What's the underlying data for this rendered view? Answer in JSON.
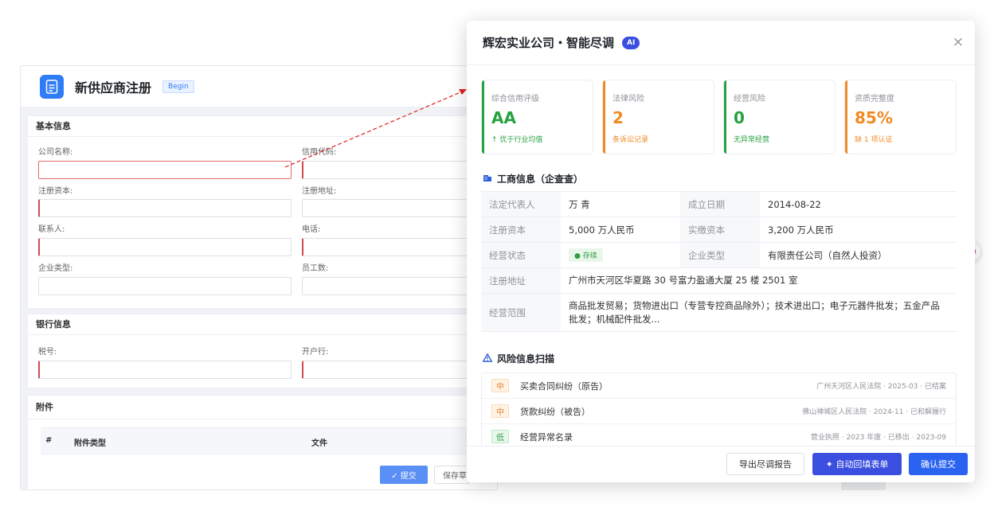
{
  "form": {
    "title": "新供应商注册",
    "tag": "Begin",
    "basic_section": "基本信息",
    "labels": {
      "company_name": "公司名称:",
      "credit_code": "信用代码:",
      "reg_capital": "注册资本:",
      "reg_address": "注册地址:",
      "contact": "联系人:",
      "phone": "电话:",
      "ent_type": "企业类型:",
      "employees": "员工数:",
      "tax_no": "税号:",
      "bank": "开户行:"
    },
    "bank_section": "银行信息",
    "attach_section": "附件",
    "attach_cols": [
      "#",
      "附件类型",
      "文件"
    ],
    "submit": "✓ 提交",
    "save_draft": "保存草"
  },
  "panel": {
    "title": "辉宏实业公司・智能尽调",
    "ai_badge": "AI",
    "close": "×",
    "cards": [
      {
        "label": "综合信用评级",
        "value": "AA",
        "sub": "↑ 优于行业均值",
        "color": "#27a243"
      },
      {
        "label": "法律风险",
        "value": "2",
        "sub": "条诉讼记录",
        "color": "#ef8a24"
      },
      {
        "label": "经营风险",
        "value": "0",
        "sub": "无异常经营",
        "color": "#27a243"
      },
      {
        "label": "资质完整度",
        "value": "85%",
        "sub": "缺 1 项认证",
        "color": "#ef8a24"
      }
    ],
    "biz_title": "工商信息（企查查）",
    "biz_rows": [
      {
        "k1": "法定代表人",
        "v1": "万 青",
        "k2": "成立日期",
        "v2": "2014-08-22"
      },
      {
        "k1": "注册资本",
        "v1": "5,000 万人民币",
        "k2": "实缴资本",
        "v2": "3,200 万人民币"
      },
      {
        "k1": "经营状态",
        "v1": "● 存续",
        "k2": "企业类型",
        "v2": "有限责任公司（自然人投资）"
      }
    ],
    "address_label": "注册地址",
    "address_value": "广州市天河区华夏路 30 号富力盈通大厦 25 楼 2501 室",
    "scope_label": "经营范围",
    "scope_value": "商品批发贸易；货物进出口（专营专控商品除外）；技术进出口；电子元器件批发；五金产品批发；机械配件批发...",
    "risk_title": "风险信息扫描",
    "risks": [
      {
        "level": "中",
        "title": "买卖合同纠纷（原告）",
        "meta": "广州天河区人民法院 · 2025-03 · 已结案"
      },
      {
        "level": "中",
        "title": "货款纠纷（被告）",
        "meta": "佛山禅城区人民法院 · 2024-11 · 已和解履行"
      },
      {
        "level": "低",
        "title": "经营异常名录",
        "meta": "营业执照 · 2023 年度 · 已移出 · 2023-09"
      }
    ],
    "buttons": {
      "export": "导出尽调报告",
      "autofill": "✦ 自动回填表单",
      "confirm": "确认提交"
    }
  }
}
